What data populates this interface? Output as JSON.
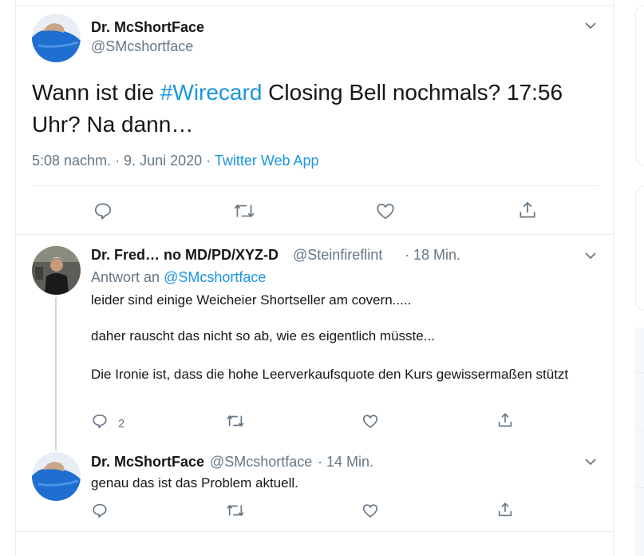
{
  "main_tweet": {
    "author_name": "Dr. McShortFace",
    "author_handle": "@SMcshortface",
    "text_before": "Wann ist die ",
    "hashtag": "#Wirecard",
    "text_after": " Closing Bell nochmals? 17:56 Uhr? Na dann…",
    "timestamp": "5:08 nachm. · 9. Juni 2020",
    "separator": " · ",
    "source": "Twitter Web App"
  },
  "reply1": {
    "author_name": "Dr. Fred… no MD/PD/XYZ-D",
    "author_handle": "@Steinfireflint",
    "time": "· 18 Min.",
    "reply_prefix": "Antwort an",
    "reply_to": "@SMcshortface",
    "lines": [
      "leider sind einige Weicheier Shortseller am covern.....",
      "daher rauscht das nicht so ab, wie es eigentlich müsste...",
      "Die Ironie ist, dass die hohe Leerverkaufsquote den Kurs gewissermaßen stützt"
    ],
    "reply_count": "2"
  },
  "reply2": {
    "author_name": "Dr. McShortFace",
    "author_handle": "@SMcshortface",
    "time": "· 14 Min.",
    "text": "genau das ist das Problem aktuell."
  },
  "icons": [
    "chevron-down-icon",
    "reply-icon",
    "retweet-icon",
    "like-icon",
    "share-icon"
  ],
  "colors": {
    "accent": "#1b95e0",
    "muted": "#657786",
    "border": "#e6ecf0",
    "thread": "#ccd6dd"
  }
}
